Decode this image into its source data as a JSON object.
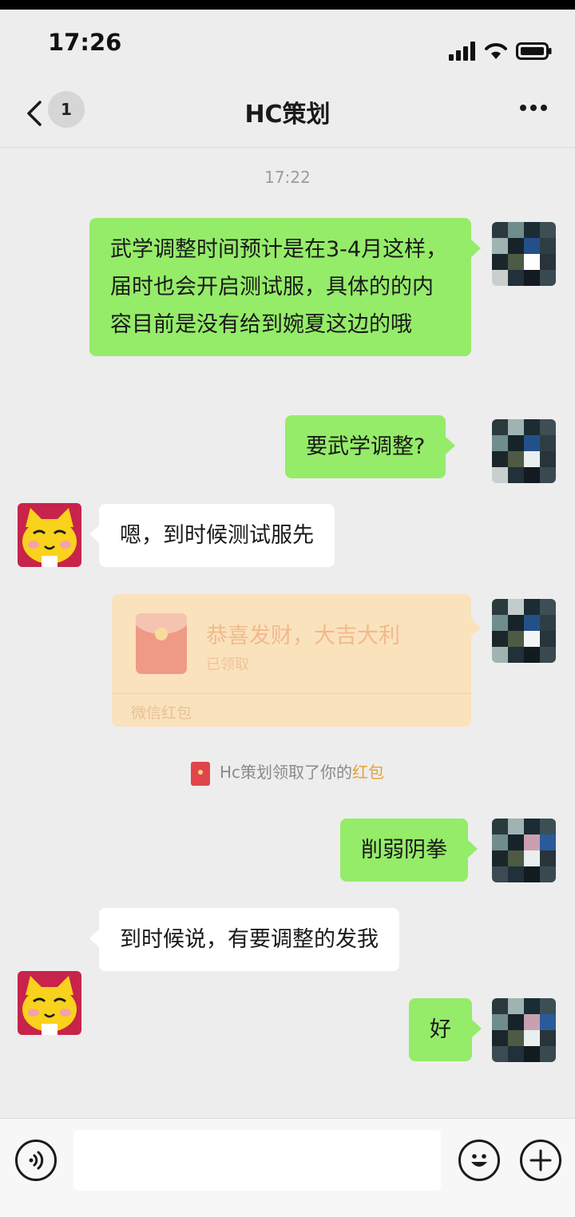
{
  "status_bar": {
    "time": "17:26"
  },
  "header": {
    "badge_count": "1",
    "title": "HC策划"
  },
  "timestamp": "17:22",
  "messages": [
    {
      "side": "right",
      "text": "武学调整时间预计是在3-4月这样，届时也会开启测试服，具体的的内容目前是没有给到婉夏这边的哦"
    },
    {
      "side": "right",
      "text": "要武学调整?"
    },
    {
      "side": "left",
      "text": "嗯，到时候测试服先"
    },
    {
      "side": "right",
      "type": "red_packet",
      "greeting": "恭喜发财，大吉大利",
      "status": "已领取",
      "footer": "微信红包"
    },
    {
      "side": "right",
      "text": "削弱阴拳"
    },
    {
      "side": "left",
      "text": "到时候说，有要调整的发我"
    },
    {
      "side": "right",
      "text": "好"
    }
  ],
  "system_notice": {
    "prefix": "Hc策划领取了你的",
    "highlight": "红包"
  },
  "colors": {
    "my_bubble": "#95ec69",
    "their_bubble": "#ffffff",
    "background": "#ededed",
    "red_packet_bg": "#fae2bd",
    "notice_highlight": "#e5a234"
  },
  "icons": [
    "back-icon",
    "more-icon",
    "voice-icon",
    "emoji-icon",
    "plus-icon",
    "red-packet-icon",
    "signal-icon",
    "wifi-icon",
    "battery-icon"
  ]
}
